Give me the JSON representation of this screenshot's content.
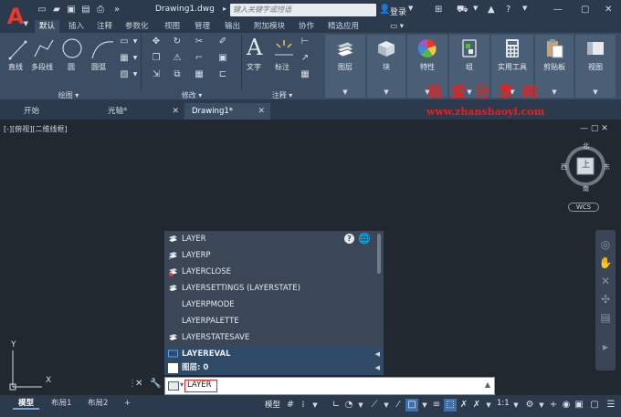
{
  "window": {
    "document_title": "Drawing1.dwg",
    "search_placeholder": "键入关键字或短语",
    "login_label": "登录"
  },
  "ribbon": {
    "tabs": [
      "默认",
      "插入",
      "注释",
      "参数化",
      "视图",
      "管理",
      "输出",
      "附加模块",
      "协作",
      "精选应用"
    ],
    "active_tab": "默认",
    "draw_tools": [
      "直线",
      "多段线",
      "圆",
      "圆弧"
    ],
    "draw_panel": "绘图",
    "modify_panel": "修改",
    "annotate_tools": [
      "文字",
      "标注"
    ],
    "annotate_panel": "注释",
    "big_tiles": [
      "图层",
      "块",
      "特性",
      "组",
      "实用工具",
      "剪贴板",
      "视图"
    ]
  },
  "watermark": {
    "chinese": "我爱分享网",
    "url": "www.zhanshaoyi.com"
  },
  "doc_tabs": {
    "items": [
      "开始",
      "光轴*",
      "Drawing1*"
    ],
    "active": "Drawing1*"
  },
  "viewport": {
    "label": "[-][俯视][二维线框]",
    "viewcube": {
      "north": "北",
      "south": "南",
      "east": "东",
      "west": "西",
      "top": "上"
    },
    "wcs": "WCS",
    "ucs_x": "X",
    "ucs_y": "Y"
  },
  "autocomplete": {
    "items": [
      "LAYER",
      "LAYERP",
      "LAYERCLOSE",
      "LAYERSETTINGS (LAYERSTATE)",
      "LAYERPMODE",
      "LAYERPALETTE",
      "LAYERSTATESAVE"
    ],
    "section": "LAYEREVAL",
    "layer_row": "图层: 0"
  },
  "command": {
    "value": "LAYER"
  },
  "status": {
    "layout_tabs": [
      "模型",
      "布局1",
      "布局2"
    ],
    "active_layout": "模型",
    "model_label": "模型",
    "scale": "1:1"
  },
  "colors": {
    "accent": "#3e6fa8",
    "logo_red": "#e8372d",
    "ribbon_bg": "#3b4e63",
    "title_bg": "#2b3a4c",
    "canvas_bg": "#212830",
    "highlight": "#e32222"
  }
}
